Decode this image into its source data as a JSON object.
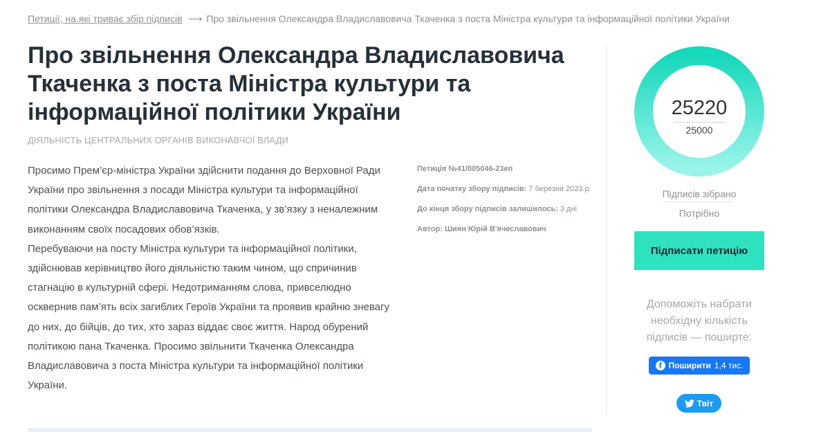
{
  "breadcrumb": {
    "parent_link": "Петиції, на які триває збір підписів",
    "arrow": "⟶",
    "current": "Про звільнення Олександра Владиславовича Ткаченка з поста Міністра культури та інформаційної політики України"
  },
  "petition": {
    "title": "Про звільнення Олександра Владиславовича Ткаченка з поста Міністра культури та інформаційної політики України",
    "category": "Діяльність центральних органів виконавчої влади",
    "paragraphs": [
      "Просимо Прем’єр-міністра України здійснити подання до Верховної Ради України про звільнення з посади Міністра культури та інформаційної політики Олександра Владиславовича Ткаченка, у зв’язку з неналежним виконанням своїх посадових обов’язків.",
      "Перебуваючи на посту Міністра культури та інформаційної політики, здійснював керівництво його діяльністю таким чином, що спричинив стагнацію в культурній сфері. Недотриманням слова, привселюдно осквернив пам’ять всіх загиблих Героїв України та проявив крайню зневагу до них, до бійців, до тих, хто зараз віддає своє життя. Народ обурений політикою пана Ткаченка. Просимо звільнити Ткаченка Олександра Владиславовича з поста Міністра культури та інформаційної політики України."
    ],
    "meta": {
      "number": "Петиція №41/005046-23еп",
      "start_label": "Дата початку збору підписів:",
      "start_value": "7 березня 2023 р.",
      "remaining_label": "До кінця збору підписів залишилось:",
      "remaining_value": "3 дні",
      "author_label": "Автор:",
      "author_value": "Шиян Юрій В'ячеславович"
    }
  },
  "signatures": {
    "collected": "25220",
    "required": "25000",
    "progress_fraction": 1.0,
    "collected_label": "Підписів зібрано",
    "required_label": "Потрібно",
    "ring_colors": [
      "#9af4ea",
      "#16d8bb"
    ]
  },
  "actions": {
    "sign_label": "Підписати петицію",
    "help_text": "Допоможіть набрати необхідну кількість підписів — поширте:",
    "facebook_label": "Поширити",
    "facebook_count": "1,4 тис.",
    "twitter_label": "Твіт",
    "facebook_color": "#1877f2",
    "twitter_color": "#1d9bf0",
    "sign_color": "#2ee2c0"
  }
}
